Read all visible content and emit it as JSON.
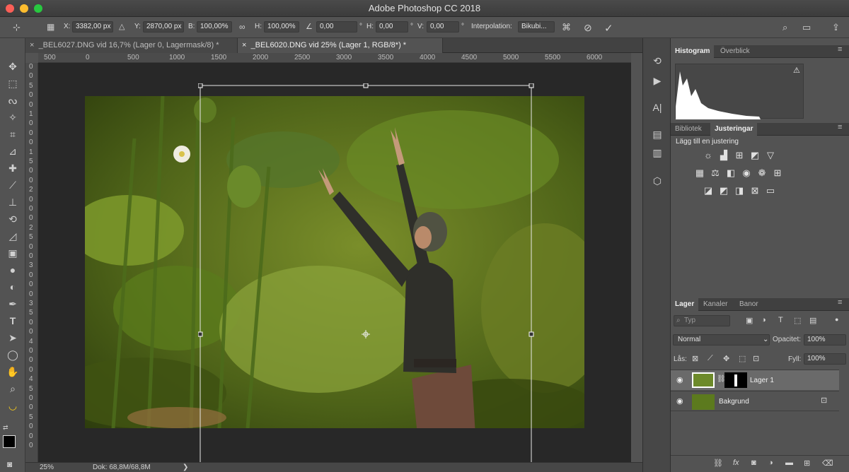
{
  "window": {
    "title": "Adobe Photoshop CC 2018"
  },
  "options_bar": {
    "x_label": "X:",
    "x_value": "3382,00 px",
    "y_label": "Y:",
    "y_value": "2870,00 px",
    "w_label": "B:",
    "w_value": "100,00%",
    "h_label": "H:",
    "h_value": "100,00%",
    "angle_value": "0,00",
    "hskew_label": "H:",
    "hskew_value": "0,00",
    "vskew_label": "V:",
    "vskew_value": "0,00",
    "degree_symbol": "°",
    "interpolation_label": "Interpolation:",
    "interpolation_value": "Bikubi...",
    "icons": [
      "reference-point-icon",
      "triangle-icon",
      "link-icon",
      "angle-icon",
      "warp-icon",
      "cancel-icon",
      "commit-icon",
      "search-icon",
      "workspace-icon",
      "share-icon"
    ]
  },
  "doc_tabs": [
    {
      "label": "_BEL6027.DNG vid 16,7% (Lager 0, Lagermask/8) *",
      "active": false
    },
    {
      "label": "_BEL6020.DNG vid 25% (Lager 1, RGB/8*) *",
      "active": true
    }
  ],
  "ruler_h": {
    "ticks": [
      "500",
      "0",
      "500",
      "1000",
      "1500",
      "2000",
      "2500",
      "3000",
      "3500",
      "4000",
      "4500",
      "5000",
      "5500",
      "6000"
    ]
  },
  "ruler_v": {
    "ticks": [
      "0",
      "0",
      "5",
      "0",
      "0",
      "1",
      "0",
      "0",
      "0",
      "1",
      "5",
      "0",
      "0",
      "2",
      "0",
      "0",
      "0",
      "2",
      "5",
      "0",
      "0",
      "3",
      "0",
      "0",
      "0",
      "3",
      "5",
      "0",
      "0",
      "4",
      "0",
      "0",
      "0",
      "4",
      "5",
      "0",
      "0",
      "5",
      "0",
      "0",
      "0"
    ]
  },
  "tools": [
    "move-icon",
    "marquee-icon",
    "lasso-icon",
    "magic-wand-icon",
    "crop-icon",
    "eyedropper-icon",
    "healing-brush-icon",
    "brush-icon",
    "clone-stamp-icon",
    "history-brush-icon",
    "eraser-icon",
    "gradient-icon",
    "blur-icon",
    "dodge-icon",
    "pen-icon",
    "type-icon",
    "path-selection-icon",
    "ellipse-icon",
    "hand-icon",
    "zoom-icon",
    "banana-icon"
  ],
  "status_bar": {
    "zoom": "25%",
    "doc": "Dok: 68,8M/68,8M",
    "arrow": "❯"
  },
  "histogram_panel": {
    "tabs": [
      "Histogram",
      "Överblick"
    ],
    "warning": "⚠"
  },
  "adjustments_panel": {
    "tabs": [
      "Bibliotek",
      "Justeringar"
    ],
    "heading": "Lägg till en justering",
    "row1": [
      "brightness-icon",
      "levels-icon",
      "curves-icon",
      "exposure-icon",
      "vibrance-icon"
    ],
    "row2": [
      "hue-saturation-icon",
      "color-balance-icon",
      "black-white-icon",
      "photo-filter-icon",
      "channel-mixer-icon",
      "color-lookup-icon"
    ],
    "row3": [
      "invert-icon",
      "posterize-icon",
      "threshold-icon",
      "selective-color-icon",
      "gradient-map-icon"
    ]
  },
  "layers_panel": {
    "tabs": [
      "Lager",
      "Kanaler",
      "Banor"
    ],
    "filter_placeholder": "Typ",
    "blend_mode": "Normal",
    "opacity_label": "Opacitet:",
    "opacity_value": "100%",
    "lock_label": "Lås:",
    "fill_label": "Fyll:",
    "fill_value": "100%",
    "layers": [
      {
        "name": "Lager 1",
        "selected": true
      },
      {
        "name": "Bakgrund",
        "selected": false
      }
    ],
    "bottom_icons": [
      "link-layers-icon",
      "fx-icon",
      "mask-icon",
      "adjustment-layer-icon",
      "group-icon",
      "new-layer-icon",
      "trash-icon"
    ]
  },
  "colors": {
    "accent": "#2f6ed1",
    "selection": "#6a6a6a"
  }
}
